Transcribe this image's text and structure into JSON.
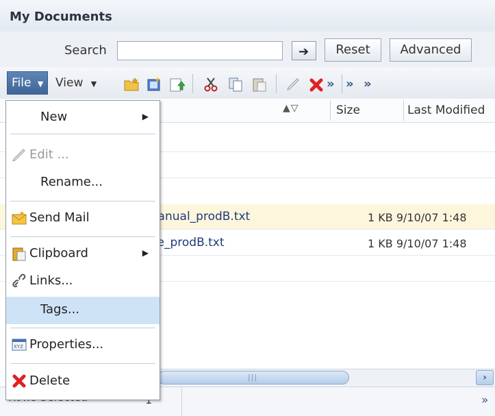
{
  "window": {
    "title": "My Documents"
  },
  "search": {
    "label": "Search",
    "value": "",
    "placeholder": "",
    "go_icon": "arrow-right-icon",
    "reset_label": "Reset",
    "advanced_label": "Advanced"
  },
  "toolbar": {
    "file_label": "File",
    "view_label": "View",
    "icons": [
      "new-folder-icon",
      "new-document-icon",
      "upload-icon",
      "cut-icon",
      "copy-icon",
      "paste-icon",
      "edit-icon",
      "delete-icon",
      "more-icon",
      "more-icon",
      "more-icon"
    ],
    "overflow_glyph": "»"
  },
  "columns": {
    "sort_glyph": "▲▽",
    "size": "Size",
    "last_modified": "Last Modified"
  },
  "rows": [
    {
      "name": "manual_prodB.txt",
      "size_modified": "1 KB 9/10/07 1:48"
    },
    {
      "name": "ide_prodB.txt",
      "size_modified": "1 KB 9/10/07 1:48"
    }
  ],
  "status": {
    "label": "Rows Selected",
    "count": "1",
    "more": "»"
  },
  "menu": {
    "items": [
      {
        "label": "New",
        "submenu": true,
        "enabled": true,
        "icon": ""
      },
      {
        "label": "Edit ...",
        "submenu": false,
        "enabled": false,
        "icon": "pencil-icon"
      },
      {
        "label": "Rename...",
        "submenu": false,
        "enabled": true,
        "icon": ""
      },
      {
        "label": "Send Mail",
        "submenu": false,
        "enabled": true,
        "icon": "mail-icon"
      },
      {
        "label": "Clipboard",
        "submenu": true,
        "enabled": true,
        "icon": "clipboard-icon"
      },
      {
        "label": "Links...",
        "submenu": false,
        "enabled": true,
        "icon": "link-icon"
      },
      {
        "label": "Tags...",
        "submenu": false,
        "enabled": true,
        "icon": "",
        "highlighted": true
      },
      {
        "label": "Properties...",
        "submenu": false,
        "enabled": true,
        "icon": "properties-icon"
      },
      {
        "label": "Delete",
        "submenu": false,
        "enabled": true,
        "icon": "delete-icon"
      }
    ],
    "submenu_glyph": "▶"
  },
  "colors": {
    "accent": "#3d6699",
    "highlight": "#cfe3f7",
    "selected_row": "#fdf6dd",
    "delete": "#e02020"
  }
}
